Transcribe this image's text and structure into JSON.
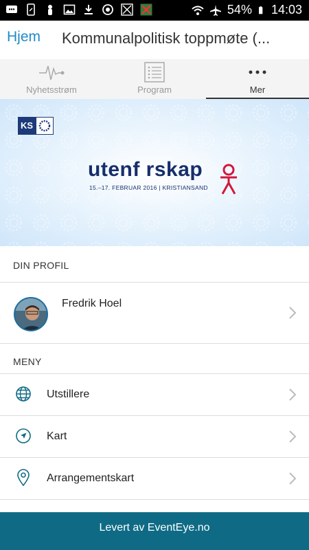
{
  "status_bar": {
    "battery": "54%",
    "time": "14:03"
  },
  "header": {
    "home_label": "Hjem",
    "title": "Kommunalpolitisk toppmøte (..."
  },
  "tabs": [
    {
      "label": "Nyhetsstrøm",
      "icon": "pulse-icon",
      "active": false
    },
    {
      "label": "Program",
      "icon": "list-icon",
      "active": false
    },
    {
      "label": "Mer",
      "icon": "more-icon",
      "active": true
    }
  ],
  "banner": {
    "logo_text": "KS",
    "title": "utenf  rskap",
    "subtitle": "15.–17. FEBRUAR 2016  |  KRISTIANSAND",
    "accent_color": "#d2173c"
  },
  "profile_section": {
    "header": "DIN PROFIL",
    "name": "Fredrik Hoel"
  },
  "menu_section": {
    "header": "MENY",
    "items": [
      {
        "label": "Utstillere",
        "icon": "globe-icon"
      },
      {
        "label": "Kart",
        "icon": "navigation-arrow-icon"
      },
      {
        "label": "Arrangementskart",
        "icon": "map-pin-icon"
      }
    ]
  },
  "footer": {
    "label": "Levert av EventEye.no",
    "color": "#0f6b85"
  }
}
